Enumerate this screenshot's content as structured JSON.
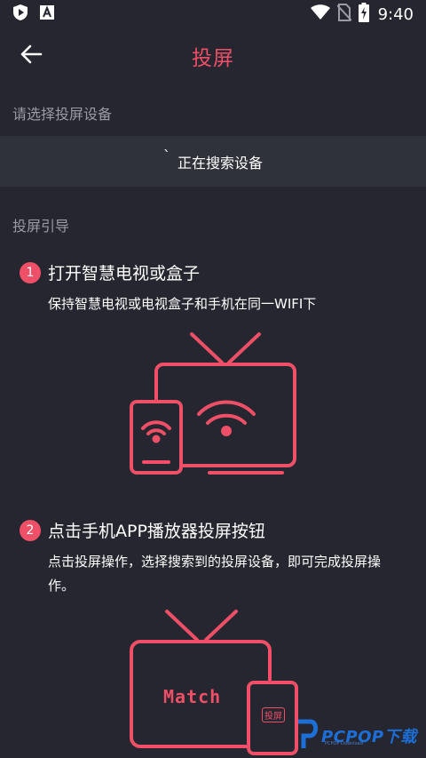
{
  "status_bar": {
    "time": "9:40",
    "icons": [
      "shield-play-icon",
      "font-a-icon",
      "wifi-icon",
      "no-sim-icon",
      "battery-charging-icon"
    ]
  },
  "app_bar": {
    "title": "投屏",
    "back_icon": "arrow-left-icon"
  },
  "device_section": {
    "label": "请选择投屏设备",
    "searching_text": "正在搜索设备",
    "spinner_glyph": "ˋ"
  },
  "guide": {
    "label": "投屏引导",
    "steps": [
      {
        "number": "1",
        "title": "打开智慧电视或盒子",
        "description": "保持智慧电视或电视盒子和手机在同一WIFI下"
      },
      {
        "number": "2",
        "title": "点击手机APP播放器投屏按钮",
        "description": "点击投屏操作，选择搜索到的投屏设备，即可完成投屏操作。"
      }
    ],
    "illustration_2": {
      "tv_text": "Match",
      "phone_text": "投屏"
    }
  },
  "watermark": {
    "text": "PCPOP下载",
    "subtext": "PCPOP Download"
  },
  "colors": {
    "background": "#25262f",
    "accent": "#ef4f67",
    "search_bar": "#30323b",
    "muted_text": "#9a9ba3"
  }
}
